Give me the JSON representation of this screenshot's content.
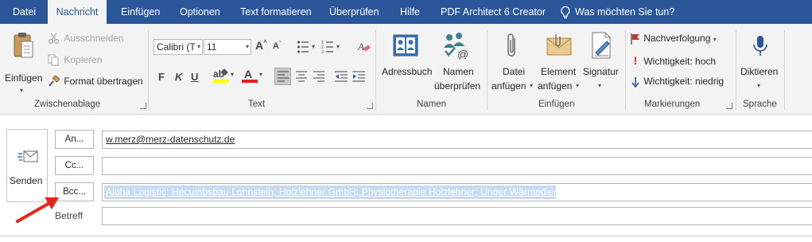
{
  "tabs": [
    {
      "label": "Datei",
      "active": false
    },
    {
      "label": "Nachricht",
      "active": true
    },
    {
      "label": "Einfügen",
      "active": false
    },
    {
      "label": "Optionen",
      "active": false
    },
    {
      "label": "Text formatieren",
      "active": false
    },
    {
      "label": "Überprüfen",
      "active": false
    },
    {
      "label": "Hilfe",
      "active": false
    },
    {
      "label": "PDF Architect 6 Creator",
      "active": false
    }
  ],
  "tellme": {
    "label": "Was möchten Sie tun?"
  },
  "clipboard": {
    "paste_label": "Einfügen",
    "cut_label": "Ausschneiden",
    "copy_label": "Kopieren",
    "format_painter_label": "Format übertragen",
    "group_label": "Zwischenablage"
  },
  "text": {
    "font_name": "Calibri (T",
    "font_size": "11",
    "bold": "F",
    "italic": "K",
    "underline": "U",
    "group_label": "Text"
  },
  "names": {
    "address_book_label": "Adressbuch",
    "check_names_line1": "Namen",
    "check_names_line2": "überprüfen",
    "group_label": "Namen"
  },
  "include": {
    "attach_file_line1": "Datei",
    "attach_file_line2": "anfügen",
    "attach_item_line1": "Element",
    "attach_item_line2": "anfügen",
    "signature_label": "Signatur",
    "group_label": "Einfügen"
  },
  "tags": {
    "follow_up_label": "Nachverfolgung",
    "high_importance_label": "Wichtigkeit: hoch",
    "low_importance_label": "Wichtigkeit: niedrig",
    "group_label": "Markierungen"
  },
  "voice": {
    "dictate_label": "Diktieren",
    "group_label": "Sprache"
  },
  "compose": {
    "send_label": "Senden",
    "to_label": "An...",
    "cc_label": "Cc...",
    "bcc_label": "Bcc...",
    "subject_label": "Betreff",
    "to_value": "w.merz@merz-datenschutz.de",
    "cc_value": "",
    "bcc_value": "Alpha Logistic; Hecumbsbau Lohnstein; Holzlehner GmbH; Physiotherapie Holzlehner; Unger Wärmedienst",
    "subject_value": ""
  },
  "colors": {
    "tabbar": "#2b579a",
    "ribbon": "#f3f3f3",
    "arrow": "#e8251d",
    "flag": "#c0392b",
    "importance_high": "#d32f2f",
    "importance_low": "#2b579a"
  }
}
